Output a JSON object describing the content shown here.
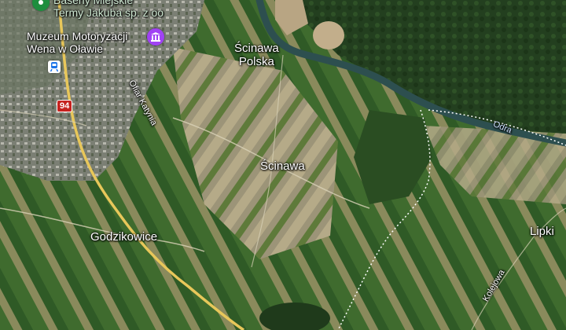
{
  "map": {
    "places": {
      "godzikowice": "Godzikowice",
      "scinawa": "Ścinawa",
      "scinawa_polska_line1": "Ścinawa",
      "scinawa_polska_line2": "Polska",
      "lipki": "Lipki"
    },
    "pois": {
      "museum_line1": "Muzeum Motoryzacji",
      "museum_line2": "Wena w Oławie",
      "pool_line1": "Baseny Miejskie",
      "pool_line2": "Termy Jakuba sp. z oo"
    },
    "streets": {
      "ofiar_katynia": "Ofiar Katynia",
      "kolejowa": "Kolejowa"
    },
    "water": {
      "odra": "Odra"
    },
    "road_shield": "94",
    "colors": {
      "museum_pin": "#a142f4",
      "pool_pin": "#1e8e3e",
      "road_shield": "#c5221f",
      "road": "#e8c75a",
      "river": "#2d4f4f"
    },
    "icons": {
      "museum": "museum-icon",
      "pool": "pool-pin-icon",
      "train": "train-station-icon"
    }
  }
}
